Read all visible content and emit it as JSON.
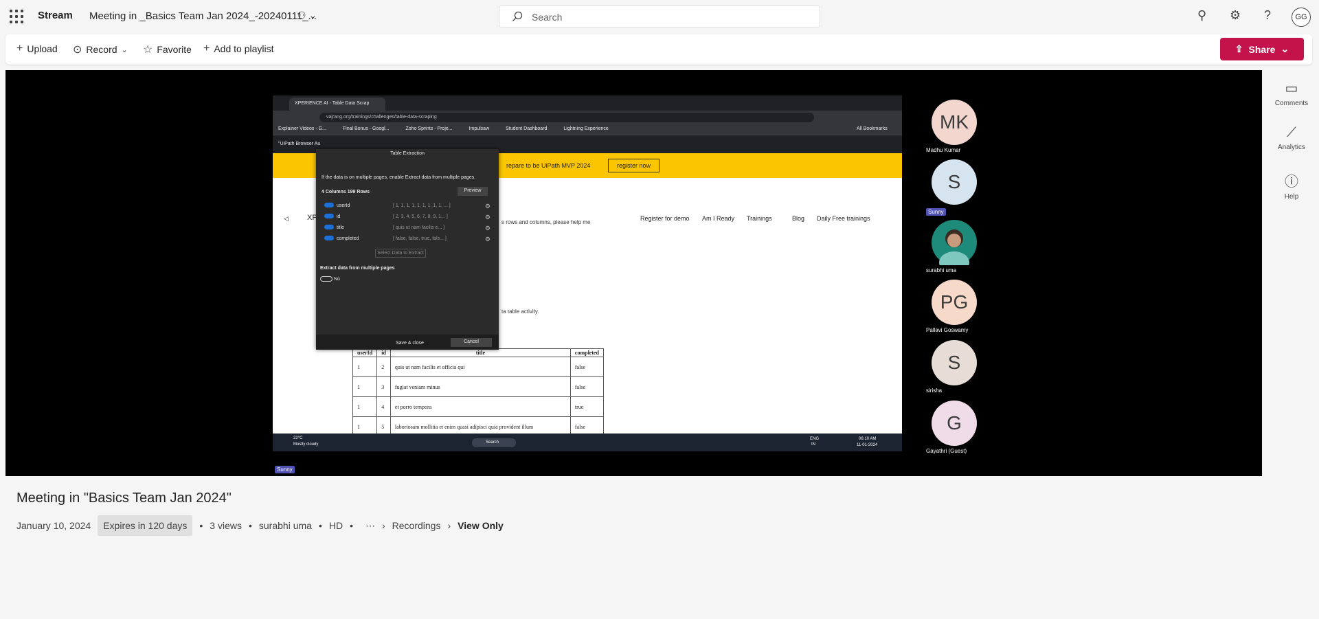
{
  "topbar": {
    "app_name": "Stream",
    "doc_title": "Meeting in _Basics Team Jan 2024_-20240111_...",
    "search_placeholder": "Search",
    "avatar_initials": "GG"
  },
  "toolbar": {
    "upload": "Upload",
    "record": "Record",
    "favorite": "Favorite",
    "add_to_playlist": "Add to playlist",
    "share": "Share"
  },
  "video": {
    "tab_title": "XPERIENCE AI - Table Data Scrap",
    "url": "vajrang.org/trainings/challenges/table-data-scraping",
    "bookmarks": [
      "Explainer Videos - G...",
      "Final Bonus - Googl...",
      "Zoho Sprints - Proje...",
      "Impulsaw",
      "Student Dashboard",
      "Lightning Experience",
      "All Bookmarks"
    ],
    "uipath_bar": "\"UiPath Browser Au",
    "banner_text": "repare to be UiPath MVP 2024",
    "banner_button": "register now",
    "site_logo": "XPER",
    "site_nav": [
      "Register for demo",
      "Am I Ready",
      "Trainings",
      "Blog",
      "Daily Free trainings"
    ],
    "page_line1": "s rows and columns, please help me",
    "page_line2": "ta table activity.",
    "table": {
      "headers": [
        "userId",
        "id",
        "title",
        "completed"
      ],
      "rows": [
        [
          "1",
          "2",
          "quis ut nam facilis et officia qui",
          "false"
        ],
        [
          "1",
          "3",
          "fugiat veniam minus",
          "false"
        ],
        [
          "1",
          "4",
          "et porro tempora",
          "true"
        ],
        [
          "1",
          "5",
          "laboriosam mollitia et enim quasi adipisci quia provident illum",
          "false"
        ]
      ]
    },
    "dialog": {
      "title": "Table Extraction",
      "hint": "If the data is on multiple pages, enable Extract data from multiple pages.",
      "columns_label": "4 Columns  199 Rows",
      "preview": "Preview",
      "fields": [
        {
          "name": "userId",
          "values": "[ 1, 1, 1, 1, 1, 1, 1, 1, 1, ... ]"
        },
        {
          "name": "id",
          "values": "[ 2, 3, 4, 5, 6, 7, 8, 9, 1... ]"
        },
        {
          "name": "title",
          "values": "[ quis ut nam facilis e... ]"
        },
        {
          "name": "completed",
          "values": "[ false, false, true, fals... ]"
        }
      ],
      "select_btn": "Select Data to Extract",
      "multi_label": "Extract data from multiple pages",
      "toggle_label": "No",
      "save": "Save & close",
      "cancel": "Cancel"
    },
    "taskbar": {
      "weather_temp": "22°C",
      "weather_desc": "Mostly cloudy",
      "search": "Search",
      "lang": "ENG",
      "region": "IN",
      "time": "06:10 AM",
      "date": "11-01-2024"
    },
    "speaker_badge": "Sunny",
    "participants": [
      {
        "initials": "MK",
        "name": "Madhu Kumar",
        "color": "#f3d7cf"
      },
      {
        "initials": "S",
        "name": "Sunny",
        "color": "#d6e4f0"
      },
      {
        "initials": "",
        "name": "surabhi uma",
        "color": "#1d8a7a"
      },
      {
        "initials": "PG",
        "name": "Pallavi Goswamy",
        "color": "#f7d9c9"
      },
      {
        "initials": "S",
        "name": "sirisha",
        "color": "#e8dcd6"
      },
      {
        "initials": "G",
        "name": "Gayathri  (Guest)",
        "color": "#f0dbe8"
      }
    ]
  },
  "rail": {
    "comments": "Comments",
    "analytics": "Analytics",
    "help": "Help"
  },
  "details": {
    "title": "Meeting in \"Basics Team Jan 2024\"",
    "date": "January 10, 2024",
    "expires": "Expires in 120 days",
    "views": "3 views",
    "owner": "surabhi uma",
    "quality": "HD",
    "recordings": "Recordings",
    "view_only": "View Only"
  }
}
